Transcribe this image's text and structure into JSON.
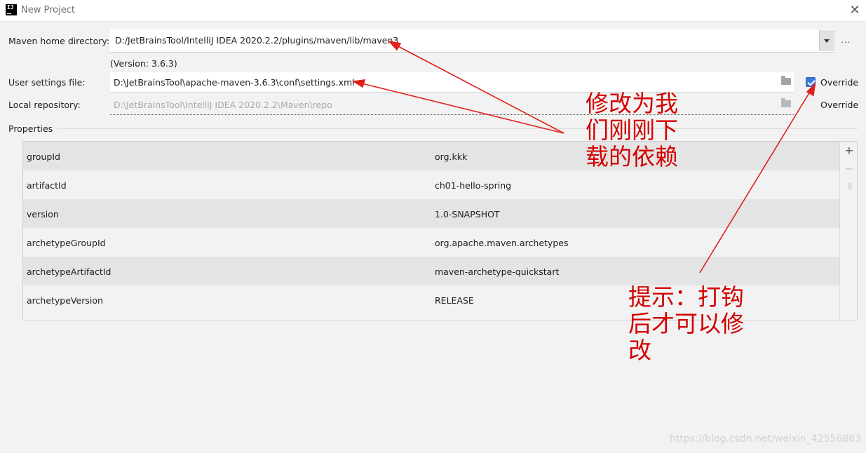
{
  "window": {
    "title": "New Project",
    "icon_text": "IJ"
  },
  "maven": {
    "home_label": "Maven home directory:",
    "home_value": "D:/JetBrainsTool/IntelliJ IDEA 2020.2.2/plugins/maven/lib/maven3",
    "browse_label": "...",
    "version_text": "(Version: 3.6.3)"
  },
  "settings": {
    "label": "User settings file:",
    "value": "D:\\JetBrainsTool\\apache-maven-3.6.3\\conf\\settings.xml",
    "override_label": "Override",
    "override_checked": true
  },
  "repository": {
    "label": "Local repository:",
    "value": "D:\\JetBrainsTool\\IntelliJ IDEA 2020.2.2\\Maven\\repo",
    "override_label": "Override",
    "override_checked": false
  },
  "properties": {
    "label": "Properties",
    "rows": [
      {
        "key": "groupId",
        "value": "org.kkk"
      },
      {
        "key": "artifactId",
        "value": "ch01-hello-spring"
      },
      {
        "key": "version",
        "value": "1.0-SNAPSHOT"
      },
      {
        "key": "archetypeGroupId",
        "value": "org.apache.maven.archetypes"
      },
      {
        "key": "archetypeArtifactId",
        "value": "maven-archetype-quickstart"
      },
      {
        "key": "archetypeVersion",
        "value": "RELEASE"
      }
    ],
    "toolbar": {
      "add": "+",
      "remove": "−",
      "edit": "✎"
    }
  },
  "annotations": {
    "modify_note": "修改为我们刚刚下载的依赖",
    "hint_note": "提示：打钩后才可以修改"
  },
  "watermark": "https://blog.csdn.net/weixin_42556863",
  "colors": {
    "annotation": "#d40000",
    "checkbox": "#3a79d7",
    "arrow": "#e0201c"
  }
}
